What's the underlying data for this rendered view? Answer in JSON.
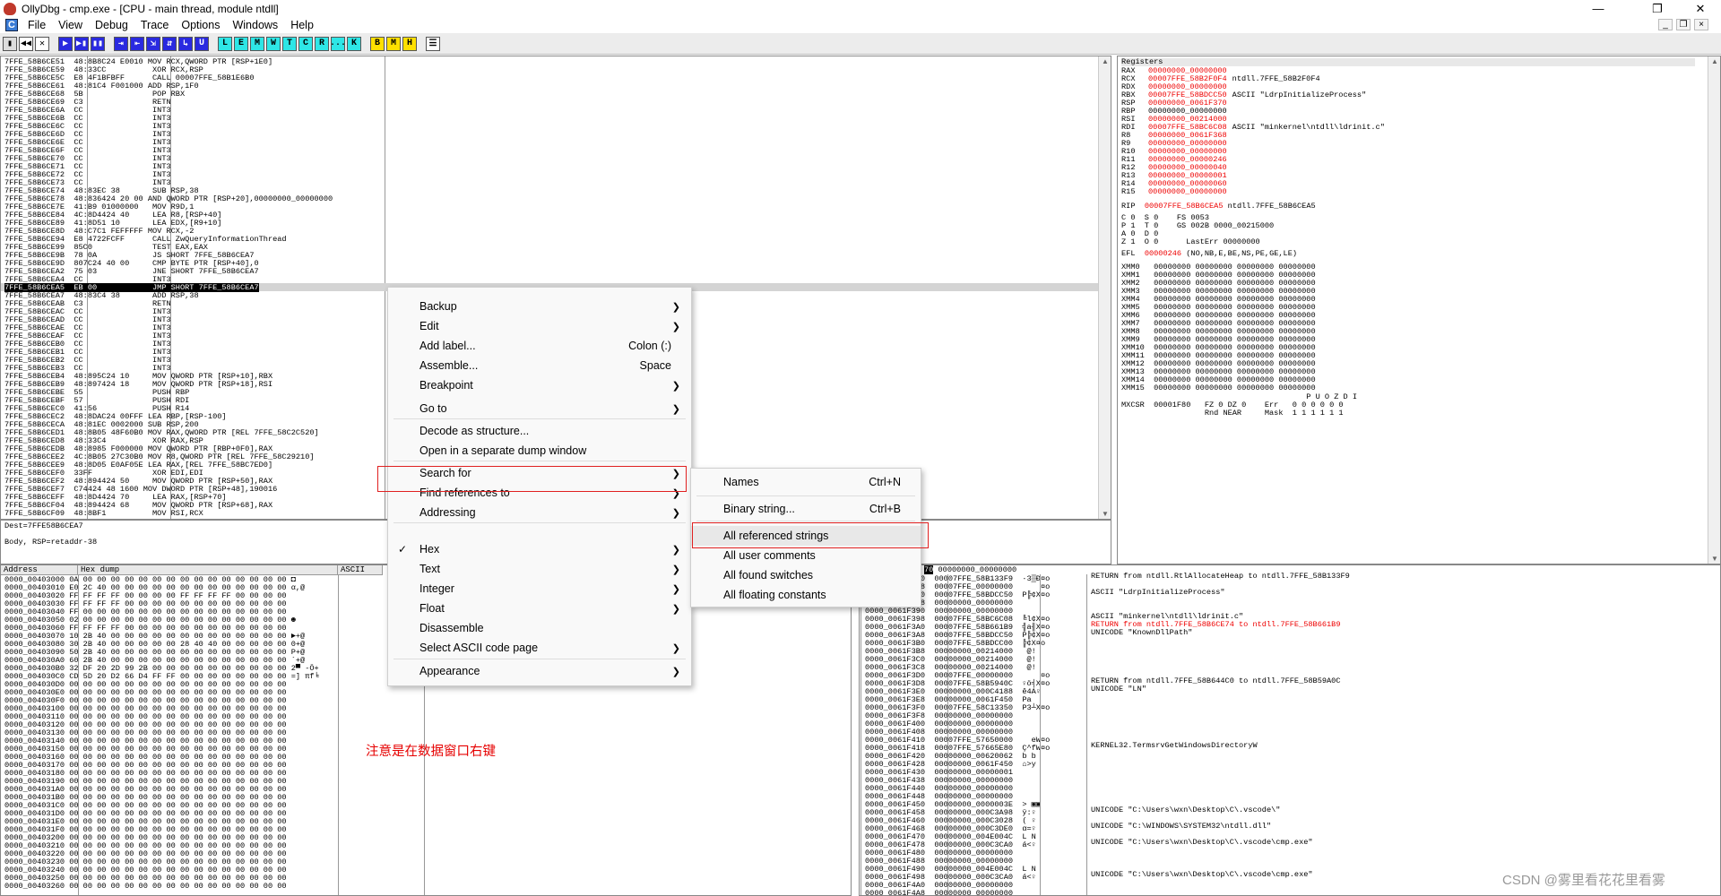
{
  "window": {
    "title": "OllyDbg - cmp.exe - [CPU - main thread, module ntdll]",
    "controls": [
      "—",
      "❐",
      "✕"
    ]
  },
  "menubar": {
    "items": [
      "File",
      "View",
      "Debug",
      "Trace",
      "Options",
      "Windows",
      "Help"
    ],
    "mdi_controls": [
      "_",
      "❐",
      "×"
    ]
  },
  "toolbar": {
    "buttons": [
      "▮",
      "◀◀",
      "✕",
      "▶",
      "▶▮",
      "▮▮",
      "⇥",
      "⇤",
      "⇲",
      "⇵",
      "↳",
      "U",
      "L",
      "E",
      "M",
      "W",
      "T",
      "C",
      "R",
      "...",
      "K",
      "B",
      "M",
      "H",
      "☰"
    ]
  },
  "cpu": {
    "rows_text": "7FFE_58B6CE51  48:8B8C24 E0010 MOV RCX,QWORD PTR [RSP+1E0]\n7FFE_58B6CE59  48:33CC          XOR RCX,RSP\n7FFE_58B6CE5C  E8 4F1BFBFF      CALL 00007FFE_58B1E6B0\n7FFE_58B6CE61  48:81C4 F001000 ADD RSP,1F0\n7FFE_58B6CE68  5B               POP RBX\n7FFE_58B6CE69  C3               RETN\n7FFE_58B6CE6A  CC               INT3\n7FFE_58B6CE6B  CC               INT3\n7FFE_58B6CE6C  CC               INT3\n7FFE_58B6CE6D  CC               INT3\n7FFE_58B6CE6E  CC               INT3\n7FFE_58B6CE6F  CC               INT3\n7FFE_58B6CE70  CC               INT3\n7FFE_58B6CE71  CC               INT3\n7FFE_58B6CE72  CC               INT3\n7FFE_58B6CE73  CC               INT3\n7FFE_58B6CE74  48:83EC 38       SUB RSP,38\n7FFE_58B6CE78  48:836424 20 00 AND QWORD PTR [RSP+20],00000000_00000000\n7FFE_58B6CE7E  41:B9 01000000   MOV R9D,1\n7FFE_58B6CE84  4C:8D4424 40     LEA R8,[RSP+40]\n7FFE_58B6CE89  41:8D51 10       LEA EDX,[R9+10]\n7FFE_58B6CE8D  48:C7C1 FEFFFFF MOV RCX,-2\n7FFE_58B6CE94  E8 4722FCFF      CALL ZwQueryInformationThread\n7FFE_58B6CE99  85C0             TEST EAX,EAX\n7FFE_58B6CE9B  78 0A            JS SHORT 7FFE_58B6CEA7\n7FFE_58B6CE9D  807C24 40 00     CMP BYTE PTR [RSP+40],0\n7FFE_58B6CEA2  75 03            JNE SHORT 7FFE_58B6CEA7\n7FFE_58B6CEA4  CC               INT3",
    "selected_row": "7FFE_58B6CEA5  EB 00            JMP SHORT 7FFE_58B6CEA7",
    "rows_text2": "7FFE_58B6CEA7  48:83C4 38       ADD RSP,38\n7FFE_58B6CEAB  C3               RETN\n7FFE_58B6CEAC  CC               INT3\n7FFE_58B6CEAD  CC               INT3\n7FFE_58B6CEAE  CC               INT3\n7FFE_58B6CEAF  CC               INT3\n7FFE_58B6CEB0  CC               INT3\n7FFE_58B6CEB1  CC               INT3\n7FFE_58B6CEB2  CC               INT3\n7FFE_58B6CEB3  CC               INT3\n7FFE_58B6CEB4  48:895C24 10     MOV QWORD PTR [RSP+10],RBX\n7FFE_58B6CEB9  48:897424 18     MOV QWORD PTR [RSP+18],RSI\n7FFE_58B6CEBE  55               PUSH RBP\n7FFE_58B6CEBF  57               PUSH RDI\n7FFE_58B6CEC0  41:56            PUSH R14\n7FFE_58B6CEC2  48:8DAC24 00FFF LEA RBP,[RSP-100]\n7FFE_58B6CECA  48:81EC 0002000 SUB RSP,200\n7FFE_58B6CED1  48:8B05 48F60B0 MOV RAX,QWORD PTR [REL 7FFE_58C2C520]\n7FFE_58B6CED8  48:33C4          XOR RAX,RSP\n7FFE_58B6CEDB  48:8985 F000000 MOV QWORD PTR [RBP+0F0],RAX\n7FFE_58B6CEE2  4C:8B05 27C30B0 MOV R8,QWORD PTR [REL 7FFE_58C29210]\n7FFE_58B6CEE9  48:8D05 E0AF05E LEA RAX,[REL 7FFE_58BC7ED0]\n7FFE_58B6CEF0  33FF             XOR EDI,EDI\n7FFE_58B6CEF2  48:894424 50     MOV QWORD PTR [RSP+50],RAX\n7FFE_58B6CEF7  C74424 48 1600 MOV DWORD PTR [RSP+48],190016\n7FFE_58B6CEFF  48:8D4424 70     LEA RAX,[RSP+70]\n7FFE_58B6CF04  48:894424 68     MOV QWORD PTR [RSP+68],RAX\n7FFE_58B6CF09  48:8BF1          MOV RSI,RCX",
    "info_lines": [
      "Dest=7FFE58B6CEA7",
      "Body, RSP=retaddr-38"
    ]
  },
  "registers": {
    "header": "Registers",
    "lines": [
      {
        "name": "RAX",
        "value": "00000000_00000000",
        "red": true,
        "comment": ""
      },
      {
        "name": "RCX",
        "value": "00007FFE_58B2F0F4",
        "red": true,
        "comment": "ntdll.7FFE_58B2F0F4"
      },
      {
        "name": "RDX",
        "value": "00000000_00000000",
        "red": true,
        "comment": ""
      },
      {
        "name": "RBX",
        "value": "00007FFE_58BDCC50",
        "red": true,
        "comment": "ASCII \"LdrpInitializeProcess\""
      },
      {
        "name": "RSP",
        "value": "00000000_0061F370",
        "red": true,
        "comment": ""
      },
      {
        "name": "RBP",
        "value": "00000000_00000000",
        "red": false,
        "comment": ""
      },
      {
        "name": "RSI",
        "value": "00000000_00214000",
        "red": true,
        "comment": ""
      },
      {
        "name": "RDI",
        "value": "00007FFE_58BC6C08",
        "red": true,
        "comment": "ASCII \"minkernel\\ntdll\\ldrinit.c\""
      },
      {
        "name": "R8",
        "value": "00000000_0061F368",
        "red": true,
        "comment": ""
      },
      {
        "name": "R9",
        "value": "00000000_00000000",
        "red": true,
        "comment": ""
      },
      {
        "name": "R10",
        "value": "00000000_00000000",
        "red": true,
        "comment": ""
      },
      {
        "name": "R11",
        "value": "00000000_00000246",
        "red": true,
        "comment": ""
      },
      {
        "name": "R12",
        "value": "00000000_00000040",
        "red": true,
        "comment": ""
      },
      {
        "name": "R13",
        "value": "00000000_00000001",
        "red": true,
        "comment": ""
      },
      {
        "name": "R14",
        "value": "00000000_00000060",
        "red": true,
        "comment": ""
      },
      {
        "name": "R15",
        "value": "00000000_00000000",
        "red": true,
        "comment": ""
      }
    ],
    "rip_label": "RIP",
    "rip_value": "00007FFE_58B6CEA5",
    "rip_comment": "ntdll.7FFE_58B6CEA5",
    "flags_text": "C 0  S 0    FS 0053\nP 1  T 0    GS 002B 0000_00215000\nA 0  D 0\nZ 1  O 0      LastErr 00000000",
    "efl_label": "EFL",
    "efl_value": "00000246",
    "efl_comment": "(NO,NB,E,BE,NS,PE,GE,LE)",
    "xmm_text": "XMM0   00000000 00000000 00000000 00000000\nXMM1   00000000 00000000 00000000 00000000\nXMM2   00000000 00000000 00000000 00000000\nXMM3   00000000 00000000 00000000 00000000\nXMM4   00000000 00000000 00000000 00000000\nXMM5   00000000 00000000 00000000 00000000\nXMM6   00000000 00000000 00000000 00000000\nXMM7   00000000 00000000 00000000 00000000\nXMM8   00000000 00000000 00000000 00000000\nXMM9   00000000 00000000 00000000 00000000\nXMM10  00000000 00000000 00000000 00000000\nXMM11  00000000 00000000 00000000 00000000\nXMM12  00000000 00000000 00000000 00000000\nXMM13  00000000 00000000 00000000 00000000\nXMM14  00000000 00000000 00000000 00000000\nXMM15  00000000 00000000 00000000 00000000",
    "mxcsr_text": "                                        P U O Z D I\nMXCSR  00001F80   FZ 0 DZ 0    Err   0 0 0 0 0 0\n                  Rnd NEAR     Mask  1 1 1 1 1 1"
  },
  "dump": {
    "headers": [
      "Address",
      "Hex dump",
      "ASCII"
    ],
    "rows_text": "0000_00403000 0A 00 00 00 00 00 00 00 00 00 00 00 00 00 00 00 ◘\n0000_00403010 E0 2C 40 00 00 00 00 00 00 00 00 00 00 00 00 00 α,@\n0000_00403020 FF FF FF FF 00 00 00 00 FF FF FF FF 00 00 00 00\n0000_00403030 FF FF FF FF 00 00 00 00 00 00 00 00 00 00 00 00\n0000_00403040 FF 00 00 00 00 00 00 00 00 00 00 00 00 00 00 00\n0000_00403050 02 00 00 00 00 00 00 00 00 00 00 00 00 00 00 00 ☻\n0000_00403060 FF FF FF FF 00 00 00 00 00 00 00 00 00 00 00 00\n0000_00403070 10 2B 40 00 00 00 00 00 00 00 00 00 00 00 00 00 ►+@\n0000_00403080 30 2B 40 00 00 00 00 00 28 40 40 00 00 00 00 00 0+@\n0000_00403090 50 2B 40 00 00 00 00 00 00 00 00 00 00 00 00 00 P+@\n0000_004030A0 60 2B 40 00 00 00 00 00 00 00 00 00 00 00 00 00 `+@\n0000_004030B0 32 DF 20 2D 99 2B 00 00 00 00 00 00 00 00 00 00 2▀ -Ö+\n0000_004030C0 CD 5D 20 D2 66 D4 FF FF 00 00 00 00 00 00 00 00 =] πf╘\n0000_004030D0 00 00 00 00 00 00 00 00 00 00 00 00 00 00 00 00\n0000_004030E0 00 00 00 00 00 00 00 00 00 00 00 00 00 00 00 00\n0000_004030F0 00 00 00 00 00 00 00 00 00 00 00 00 00 00 00 00\n0000_00403100 00 00 00 00 00 00 00 00 00 00 00 00 00 00 00 00\n0000_00403110 00 00 00 00 00 00 00 00 00 00 00 00 00 00 00 00\n0000_00403120 00 00 00 00 00 00 00 00 00 00 00 00 00 00 00 00\n0000_00403130 00 00 00 00 00 00 00 00 00 00 00 00 00 00 00 00\n0000_00403140 00 00 00 00 00 00 00 00 00 00 00 00 00 00 00 00\n0000_00403150 00 00 00 00 00 00 00 00 00 00 00 00 00 00 00 00\n0000_00403160 00 00 00 00 00 00 00 00 00 00 00 00 00 00 00 00\n0000_00403170 00 00 00 00 00 00 00 00 00 00 00 00 00 00 00 00\n0000_00403180 00 00 00 00 00 00 00 00 00 00 00 00 00 00 00 00\n0000_00403190 00 00 00 00 00 00 00 00 00 00 00 00 00 00 00 00\n0000_004031A0 00 00 00 00 00 00 00 00 00 00 00 00 00 00 00 00\n0000_004031B0 00 00 00 00 00 00 00 00 00 00 00 00 00 00 00 00\n0000_004031C0 00 00 00 00 00 00 00 00 00 00 00 00 00 00 00 00\n0000_004031D0 00 00 00 00 00 00 00 00 00 00 00 00 00 00 00 00\n0000_004031E0 00 00 00 00 00 00 00 00 00 00 00 00 00 00 00 00\n0000_004031F0 00 00 00 00 00 00 00 00 00 00 00 00 00 00 00 00\n0000_00403200 00 00 00 00 00 00 00 00 00 00 00 00 00 00 00 00\n0000_00403210 00 00 00 00 00 00 00 00 00 00 00 00 00 00 00 00\n0000_00403220 00 00 00 00 00 00 00 00 00 00 00 00 00 00 00 00\n0000_00403230 00 00 00 00 00 00 00 00 00 00 00 00 00 00 00 00\n0000_00403240 00 00 00 00 00 00 00 00 00 00 00 00 00 00 00 00\n0000_00403250 00 00 00 00 00 00 00 00 00 00 00 00 00 00 00 00\n0000_00403260 00 00 00 00 00 00 00 00 00 00 00 00 00 00 00 00"
  },
  "stack": {
    "header_sel": "70",
    "header_val": "00000000_00000000",
    "rows_text": "0000_0061F370  00007FFE_58B133F9  ∙3▒Ð¤o\n0000_0061F378  00007FFE_00000000      ¤o\n0000_0061F380  00007FFE_58BDCC50  P╠¢X¤o\n0000_0061F388  00000000_00000000\n0000_0061F390  00000000_00000000\n0000_0061F398  00007FFE_58BC6C08  ╚l¢X¤o\n0000_0061F3A0  00007FFE_58B661B9  ╣a╢X¤o\n0000_0061F3A8  00007FFE_58BDCC50  P╠¢X¤o\n0000_0061F3B0  00007FFE_58BDCC00  ╠¢X¤o\n0000_0061F3B8  00000000_00214000   @!\n0000_0061F3C0  00000000_00214000   @!\n0000_0061F3C8  00000000_00214000   @!\n0000_0061F3D0  00007FFE_00000000      ¤o\n0000_0061F3D8  00007FFE_58B5940C  ♀ö╡X¤o\n0000_0061F3E0  00000000_000C4188  ê4A♀\n0000_0061F3E8  00000000_0061F450  Pa\n0000_0061F3F0  00007FFE_58C13350  P3┴X¤o\n0000_0061F3F8  00000000_00000000\n0000_0061F400  00000000_00000000\n0000_0061F408  00000000_00000000\n0000_0061F410  00007FFE_57650000    eW¤o\n0000_0061F418  00007FFE_57665E80  Ç^fW¤o\n0000_0061F420  00000000_00620062  b b\n0000_0061F428  00000000_0061F450  ⌂>y\n0000_0061F430  00000000_00000001\n0000_0061F438  00000000_00000000\n0000_0061F440  00000000_00000000\n0000_0061F448  00000000_00000000\n0000_0061F450  00000000_0000003E  > ▣▣\n0000_0061F458  00000000_000C3A98  ÿ:♀\n0000_0061F460  00000000_000C3028  ( ♀\n0000_0061F468  00000000_000C3DE0  α=♀\n0000_0061F470  00000000_004E004C  L N\n0000_0061F478  00000000_000C3CA0  á<♀\n0000_0061F480  00000000_00000000\n0000_0061F488  00000000_00000000\n0000_0061F490  00000000_004E004C  L N\n0000_0061F498  00000000_000C3CA0  á<♀\n0000_0061F4A0  00000000_00000000\n0000_0061F4A8  00000000_00000000\n0000_0061F4B0  00000000_00400080  Ç @",
    "comments_text": "RETURN from ntdll.RtlAllocateHeap to ntdll.7FFE_58B133F9\n\nASCII \"LdrpInitializeProcess\"\n\n\nASCII \"minkernel\\ntdll\\ldrinit.c\"\n[[RED]]\nUNICODE \"KnownDllPath\"\n\n\n\n\n\nRETURN from ntdll.7FFE_58B644C0 to ntdll.7FFE_58B59A0C\nUNICODE \"LN\"\n\n\n\n\n\n\nKERNEL32.TermsrvGetWindowsDirectoryW\n\n\n\n\n\n\n\nUNICODE \"C:\\Users\\wxn\\Desktop\\C\\.vscode\\\"\n\nUNICODE \"C:\\WINDOWS\\SYSTEM32\\ntdll.dll\"\n\nUNICODE \"C:\\Users\\wxn\\Desktop\\C\\.vscode\\cmp.exe\"\n\n\n\nUNICODE \"C:\\Users\\wxn\\Desktop\\C\\.vscode\\cmp.exe\"\n\n\nASCII \"PE\"",
    "red_comment": "RETURN from ntdll.7FFE_58B6CE74 to ntdll.7FFE_58B661B9"
  },
  "context_menu": {
    "items": [
      {
        "label": "Backup",
        "shortcut": "",
        "submenu": true
      },
      {
        "label": "Edit",
        "shortcut": "",
        "submenu": true
      },
      {
        "label": "Add label...",
        "shortcut": "Colon (:)",
        "submenu": false
      },
      {
        "label": "Assemble...",
        "shortcut": "Space",
        "submenu": false
      },
      {
        "label": "Breakpoint",
        "shortcut": "",
        "submenu": true
      },
      {
        "label": "Go to",
        "shortcut": "",
        "submenu": true
      },
      {
        "label": "Decode as structure...",
        "shortcut": "",
        "submenu": false
      },
      {
        "label": "Open in a separate dump window",
        "shortcut": "",
        "submenu": false
      },
      {
        "label": "Search for",
        "shortcut": "",
        "submenu": true
      },
      {
        "label": "Find references to",
        "shortcut": "",
        "submenu": true
      },
      {
        "label": "Addressing",
        "shortcut": "",
        "submenu": true
      },
      {
        "label": "Hex",
        "shortcut": "",
        "submenu": true,
        "checked": true
      },
      {
        "label": "Text",
        "shortcut": "",
        "submenu": true
      },
      {
        "label": "Integer",
        "shortcut": "",
        "submenu": true
      },
      {
        "label": "Float",
        "shortcut": "",
        "submenu": true
      },
      {
        "label": "Disassemble",
        "shortcut": "",
        "submenu": false
      },
      {
        "label": "Select ASCII code page",
        "shortcut": "",
        "submenu": true
      },
      {
        "label": "Appearance",
        "shortcut": "",
        "submenu": true
      }
    ],
    "check_glyph": "✓",
    "arrow_glyph": "❯"
  },
  "submenu": {
    "items": [
      {
        "label": "Names",
        "shortcut": "Ctrl+N"
      },
      {
        "label": "Binary string...",
        "shortcut": "Ctrl+B"
      },
      {
        "label": "All referenced strings",
        "shortcut": ""
      },
      {
        "label": "All user comments",
        "shortcut": ""
      },
      {
        "label": "All found switches",
        "shortcut": ""
      },
      {
        "label": "All floating constants",
        "shortcut": ""
      }
    ]
  },
  "annotation": "注意是在数据窗口右键",
  "watermark": "CSDN @雾里看花花里看雾",
  "colors": {
    "highlight_box": "#e02020",
    "register_changed": "#ee0000"
  }
}
